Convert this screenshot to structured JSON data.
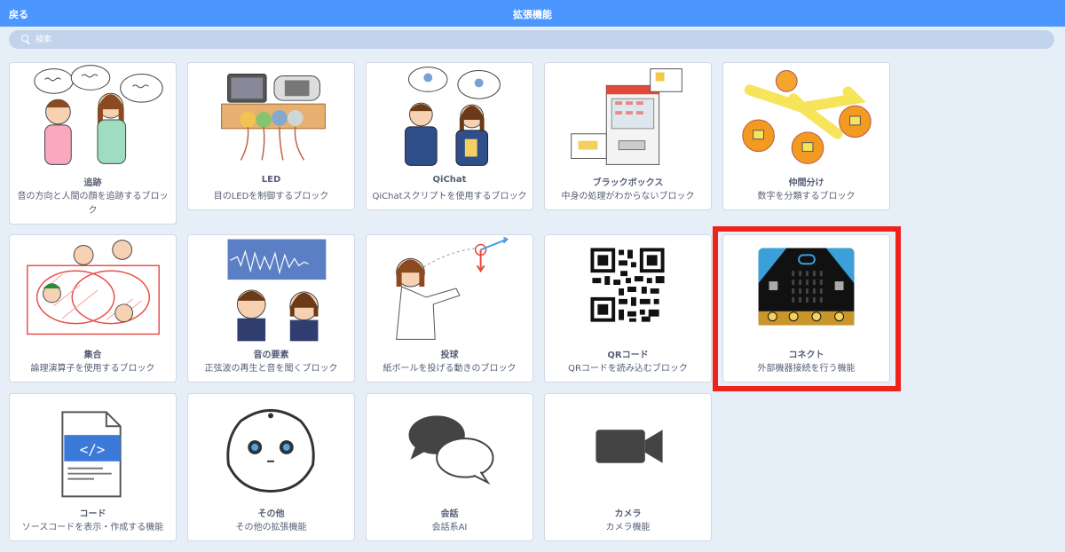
{
  "header": {
    "back_label": "戻る",
    "title": "拡張機能"
  },
  "search": {
    "placeholder": "検索"
  },
  "extensions": [
    {
      "name": "追跡",
      "desc": "音の方向と人間の顔を追跡するブロック",
      "icon": "people-talking-illustration"
    },
    {
      "name": "LED",
      "desc": "目のLEDを制御するブロック",
      "icon": "led-illustration"
    },
    {
      "name": "QiChat",
      "desc": "QiChatスクリプトを使用するブロック",
      "icon": "qichat-illustration"
    },
    {
      "name": "ブラックボックス",
      "desc": "中身の処理がわからないブロック",
      "icon": "vending-machine-illustration"
    },
    {
      "name": "仲間分け",
      "desc": "数字を分類するブロック",
      "icon": "sorting-oranges-illustration"
    },
    {
      "name": "集合",
      "desc": "論理演算子を使用するブロック",
      "icon": "venn-diagram-illustration"
    },
    {
      "name": "音の要素",
      "desc": "正弦波の再生と音を聞くブロック",
      "icon": "soundwave-illustration"
    },
    {
      "name": "投球",
      "desc": "紙ボールを投げる動きのブロック",
      "icon": "throwing-illustration"
    },
    {
      "name": "QRコード",
      "desc": "QRコードを読み込むブロック",
      "icon": "qr-code-icon"
    },
    {
      "name": "コネクト",
      "desc": "外部機器接続を行う機能",
      "icon": "microbit-board-icon"
    },
    {
      "name": "コード",
      "desc": "ソースコードを表示・作成する機能",
      "icon": "code-file-icon"
    },
    {
      "name": "その他",
      "desc": "その他の拡張機能",
      "icon": "robot-face-icon"
    },
    {
      "name": "会話",
      "desc": "会話系AI",
      "icon": "speech-bubbles-icon"
    },
    {
      "name": "カメラ",
      "desc": "カメラ機能",
      "icon": "video-camera-icon"
    }
  ],
  "colors": {
    "header": "#4c97ff",
    "background": "#e6eef8",
    "highlight": "#f0231c",
    "text": "#575e75"
  }
}
